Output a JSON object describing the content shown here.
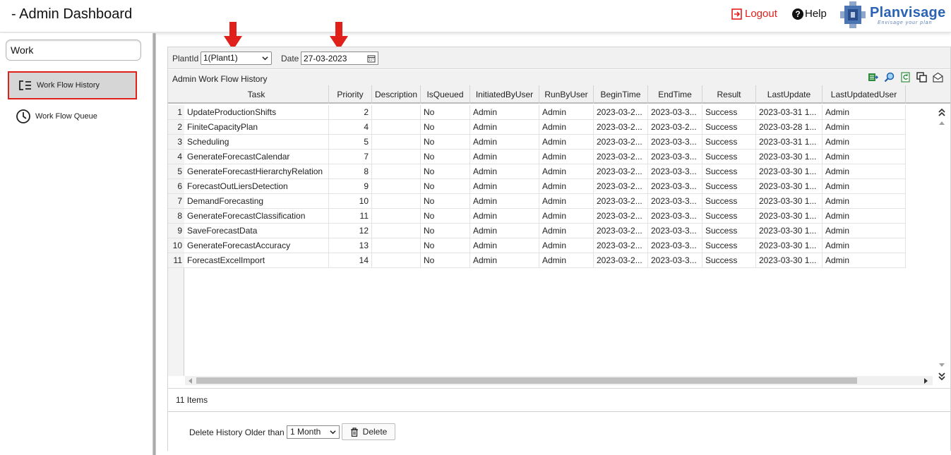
{
  "header": {
    "title": "- Admin Dashboard",
    "logout_label": "Logout",
    "help_label": "Help",
    "logo_text": "Planvisage",
    "logo_tagline": "Envisage your plan"
  },
  "sidebar": {
    "search_value": "Work",
    "items": [
      {
        "label": "Work Flow History",
        "icon": "workflow-list-icon",
        "active": true
      },
      {
        "label": "Work Flow Queue",
        "icon": "clock-icon",
        "active": false
      }
    ]
  },
  "filters": {
    "plant_label": "PlantId",
    "plant_value": "1(Plant1)",
    "date_label": "Date",
    "date_value": "27-03-2023"
  },
  "grid": {
    "caption": "Admin Work Flow History",
    "columns": [
      "Task",
      "Priority",
      "Description",
      "IsQueued",
      "InitiatedByUser",
      "RunByUser",
      "BeginTime",
      "EndTime",
      "Result",
      "LastUpdate",
      "LastUpdatedUser"
    ],
    "rows": [
      {
        "n": "1",
        "task": "UpdateProductionShifts",
        "priority": "2",
        "description": "",
        "isqueued": "No",
        "initiated": "Admin",
        "runby": "Admin",
        "begin": "2023-03-2...",
        "end": "2023-03-3...",
        "result": "Success",
        "lastupdate": "2023-03-31 1...",
        "lastuser": "Admin"
      },
      {
        "n": "2",
        "task": "FiniteCapacityPlan",
        "priority": "4",
        "description": "",
        "isqueued": "No",
        "initiated": "Admin",
        "runby": "Admin",
        "begin": "2023-03-2...",
        "end": "2023-03-2...",
        "result": "Success",
        "lastupdate": "2023-03-28 1...",
        "lastuser": "Admin"
      },
      {
        "n": "3",
        "task": "Scheduling",
        "priority": "5",
        "description": "",
        "isqueued": "No",
        "initiated": "Admin",
        "runby": "Admin",
        "begin": "2023-03-2...",
        "end": "2023-03-3...",
        "result": "Success",
        "lastupdate": "2023-03-31 1...",
        "lastuser": "Admin"
      },
      {
        "n": "4",
        "task": "GenerateForecastCalendar",
        "priority": "7",
        "description": "",
        "isqueued": "No",
        "initiated": "Admin",
        "runby": "Admin",
        "begin": "2023-03-2...",
        "end": "2023-03-3...",
        "result": "Success",
        "lastupdate": "2023-03-30 1...",
        "lastuser": "Admin"
      },
      {
        "n": "5",
        "task": "GenerateForecastHierarchyRelation",
        "priority": "8",
        "description": "",
        "isqueued": "No",
        "initiated": "Admin",
        "runby": "Admin",
        "begin": "2023-03-2...",
        "end": "2023-03-3...",
        "result": "Success",
        "lastupdate": "2023-03-30 1...",
        "lastuser": "Admin"
      },
      {
        "n": "6",
        "task": "ForecastOutLiersDetection",
        "priority": "9",
        "description": "",
        "isqueued": "No",
        "initiated": "Admin",
        "runby": "Admin",
        "begin": "2023-03-2...",
        "end": "2023-03-3...",
        "result": "Success",
        "lastupdate": "2023-03-30 1...",
        "lastuser": "Admin"
      },
      {
        "n": "7",
        "task": "DemandForecasting",
        "priority": "10",
        "description": "",
        "isqueued": "No",
        "initiated": "Admin",
        "runby": "Admin",
        "begin": "2023-03-2...",
        "end": "2023-03-3...",
        "result": "Success",
        "lastupdate": "2023-03-30 1...",
        "lastuser": "Admin"
      },
      {
        "n": "8",
        "task": "GenerateForecastClassification",
        "priority": "11",
        "description": "",
        "isqueued": "No",
        "initiated": "Admin",
        "runby": "Admin",
        "begin": "2023-03-2...",
        "end": "2023-03-3...",
        "result": "Success",
        "lastupdate": "2023-03-30 1...",
        "lastuser": "Admin"
      },
      {
        "n": "9",
        "task": "SaveForecastData",
        "priority": "12",
        "description": "",
        "isqueued": "No",
        "initiated": "Admin",
        "runby": "Admin",
        "begin": "2023-03-2...",
        "end": "2023-03-3...",
        "result": "Success",
        "lastupdate": "2023-03-30 1...",
        "lastuser": "Admin"
      },
      {
        "n": "10",
        "task": "GenerateForecastAccuracy",
        "priority": "13",
        "description": "",
        "isqueued": "No",
        "initiated": "Admin",
        "runby": "Admin",
        "begin": "2023-03-2...",
        "end": "2023-03-3...",
        "result": "Success",
        "lastupdate": "2023-03-30 1...",
        "lastuser": "Admin"
      },
      {
        "n": "11",
        "task": "ForecastExcelImport",
        "priority": "14",
        "description": "",
        "isqueued": "No",
        "initiated": "Admin",
        "runby": "Admin",
        "begin": "2023-03-2...",
        "end": "2023-03-3...",
        "result": "Success",
        "lastupdate": "2023-03-30 1...",
        "lastuser": "Admin"
      }
    ],
    "item_count": "11 Items"
  },
  "bottom": {
    "delete_label": "Delete History Older than",
    "delete_period": "1 Month",
    "delete_button": "Delete"
  },
  "colors": {
    "accent_red": "#e0201a",
    "brand_blue": "#2a63b4"
  }
}
